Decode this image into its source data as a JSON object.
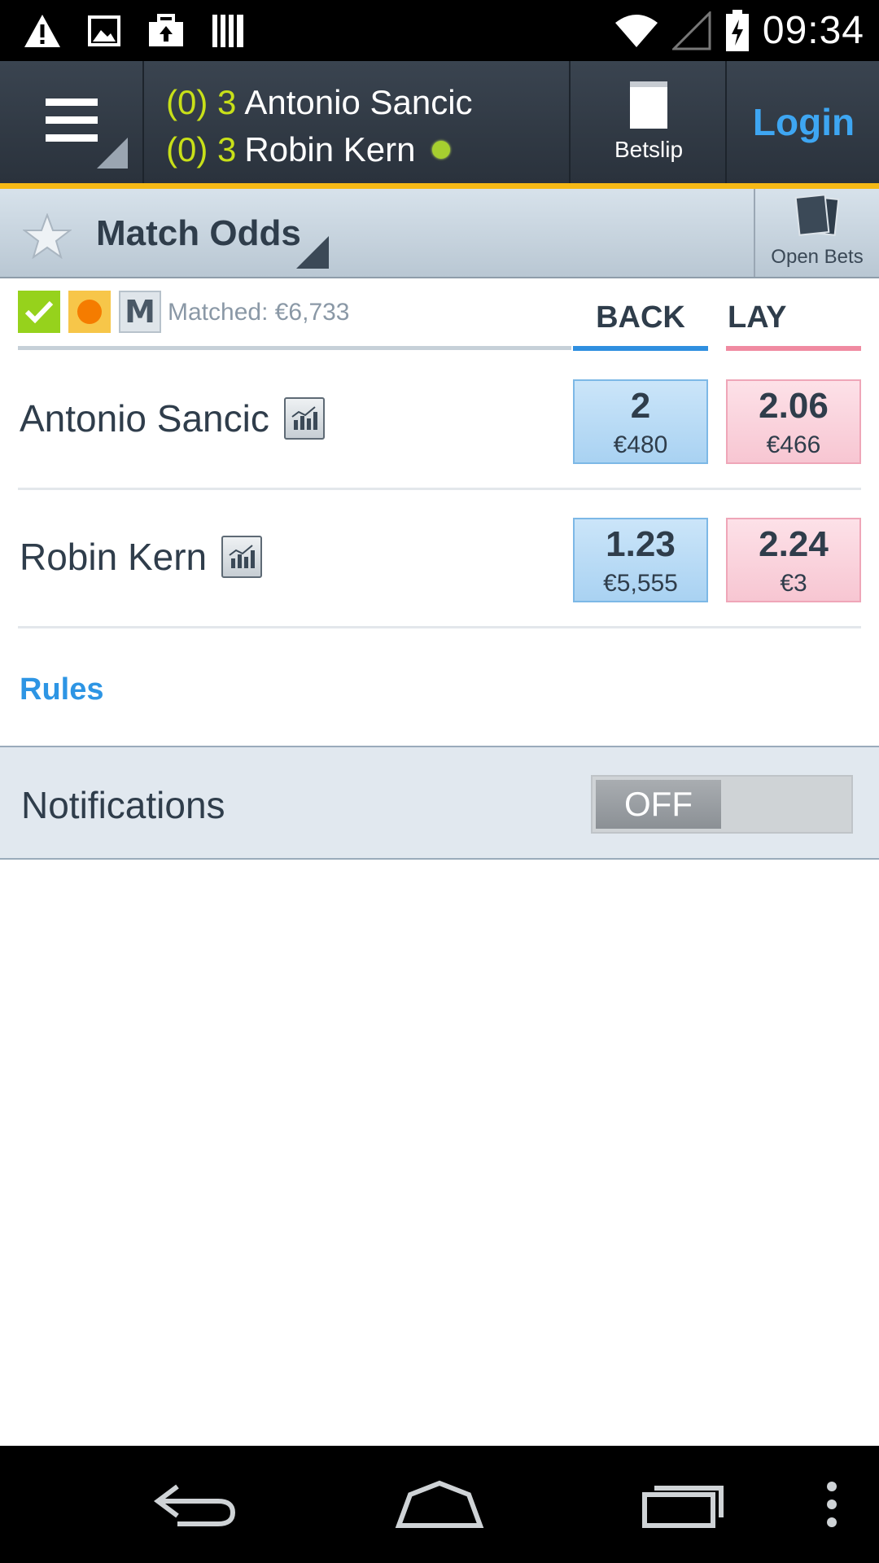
{
  "status_bar": {
    "time": "09:34",
    "left_icons": [
      "warning-icon",
      "image-icon",
      "briefcase-upload-icon",
      "barcode-icon"
    ],
    "right_icons": [
      "wifi-icon",
      "cell-signal-icon",
      "battery-charging-icon"
    ]
  },
  "header": {
    "players": [
      {
        "sets": "(0)",
        "games": "3",
        "name": "Antonio Sancic",
        "serving": false
      },
      {
        "sets": "(0)",
        "games": "3",
        "name": "Robin Kern",
        "serving": true
      }
    ],
    "betslip_label": "Betslip",
    "login_label": "Login",
    "accent_color": "#f5b916"
  },
  "market": {
    "title": "Match Odds",
    "open_bets_label": "Open Bets",
    "matched": "Matched: €6,733",
    "back_label": "BACK",
    "lay_label": "LAY",
    "badges": [
      "in-play-check-icon",
      "cash-out-icon",
      "multiples-icon"
    ],
    "multi_letter": "M"
  },
  "runners": [
    {
      "name": "Antonio Sancic",
      "back_odds": "2",
      "back_stake": "€480",
      "lay_odds": "2.06",
      "lay_stake": "€466"
    },
    {
      "name": "Robin Kern",
      "back_odds": "1.23",
      "back_stake": "€5,555",
      "lay_odds": "2.24",
      "lay_stake": "€3"
    }
  ],
  "rules_label": "Rules",
  "notifications": {
    "label": "Notifications",
    "toggle_state": "OFF"
  },
  "nav_bar": {
    "buttons": [
      "back-icon",
      "home-icon",
      "recent-apps-icon",
      "overflow-menu-icon"
    ]
  }
}
